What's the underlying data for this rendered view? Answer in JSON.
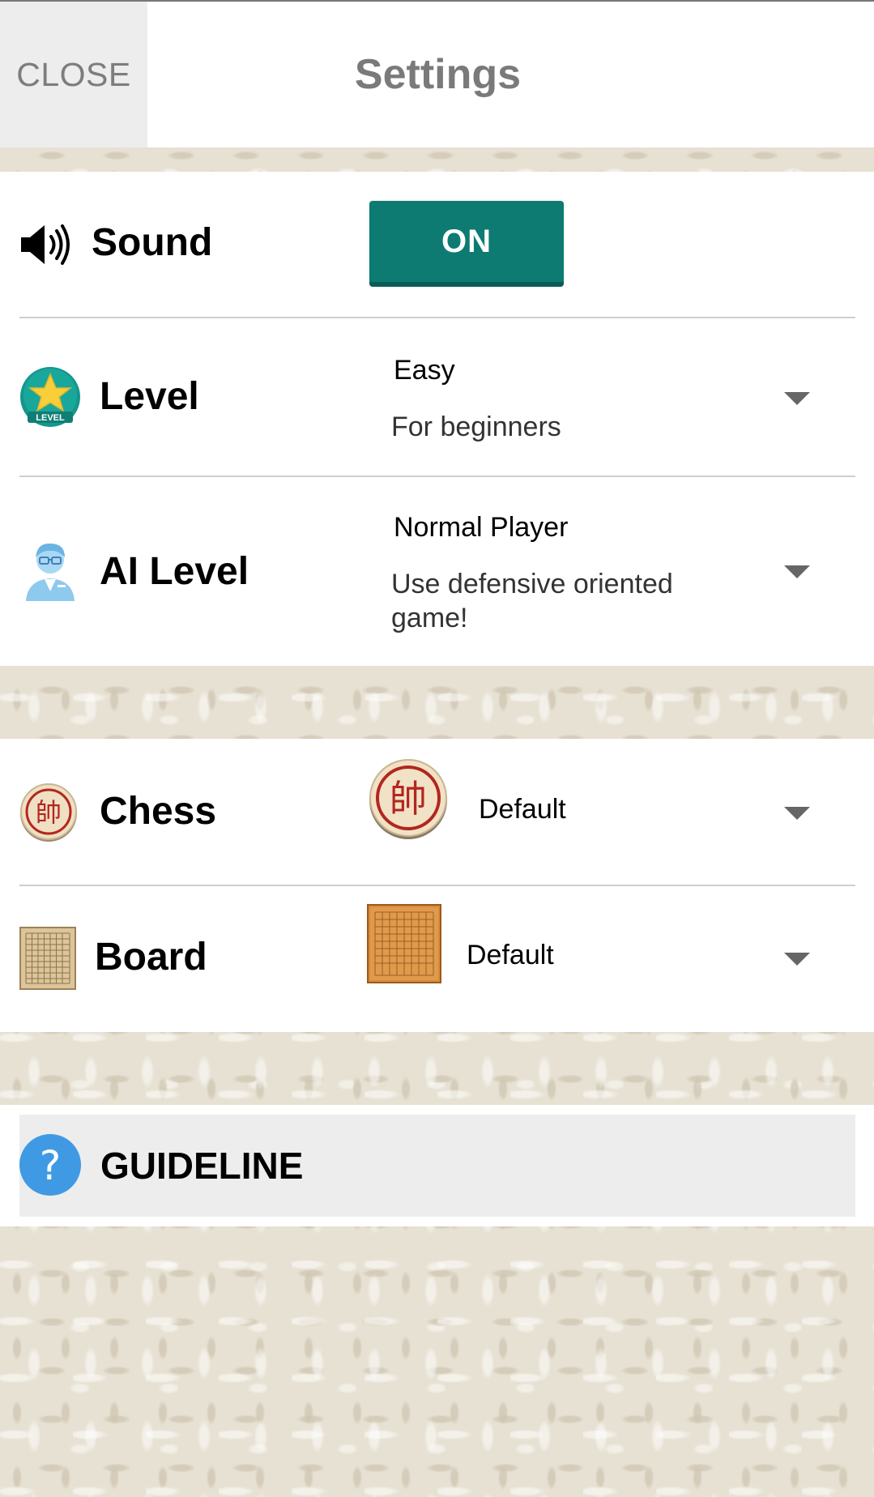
{
  "header": {
    "close_label": "CLOSE",
    "title": "Settings"
  },
  "sound": {
    "label": "Sound",
    "toggle_label": "ON",
    "icon": "speaker-icon"
  },
  "level": {
    "label": "Level",
    "selected": "Easy",
    "description": "For beginners",
    "icon": "level-star-icon",
    "icon_badge_text": "LEVEL"
  },
  "ai_level": {
    "label": "AI Level",
    "selected": "Normal Player",
    "description": "Use defensive oriented game!",
    "icon": "ai-player-icon"
  },
  "chess": {
    "label": "Chess",
    "selected": "Default",
    "icon": "chess-piece-icon",
    "piece_char": "帥"
  },
  "board": {
    "label": "Board",
    "selected": "Default",
    "icon": "board-icon"
  },
  "guideline": {
    "label": "GUIDELINE",
    "icon": "help-icon",
    "icon_char": "?"
  },
  "colors": {
    "accent": "#0d7b72",
    "help_blue": "#3f9ae3",
    "piece_red": "#b3261e"
  }
}
